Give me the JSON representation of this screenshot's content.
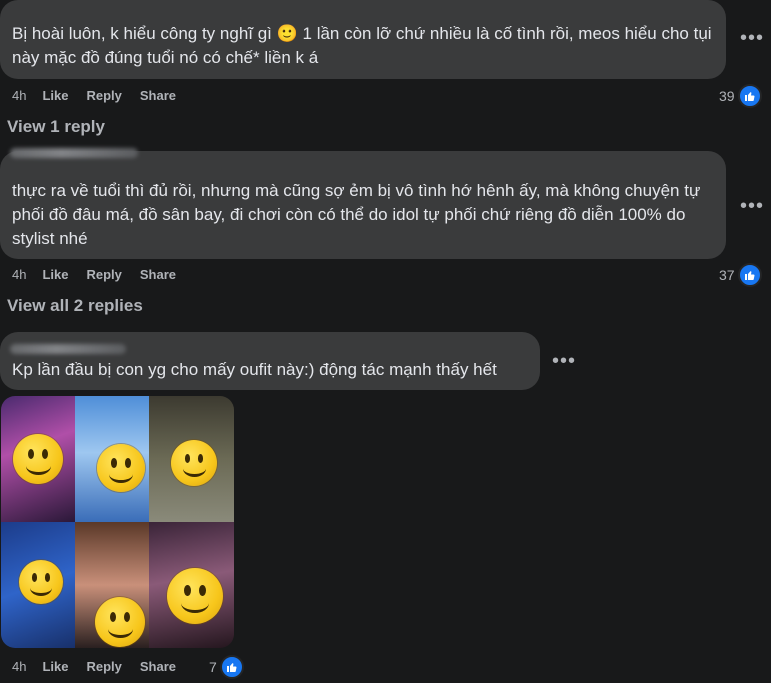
{
  "comments": [
    {
      "text": "Bị hoài luôn, k hiểu công ty nghĩ gì 🙂 1 lần còn lỡ chứ nhiều là cố tình rồi, meos hiểu cho tụi này mặc đồ đúng tuổi nó có chế* liền k á",
      "time": "4h",
      "like_label": "Like",
      "reply_label": "Reply",
      "share_label": "Share",
      "reaction_count": "39",
      "view_replies": "View 1 reply"
    },
    {
      "text": "thực ra về tuổi thì đủ rồi, nhưng mà cũng sợ ẻm bị vô tình hớ hênh ấy, mà không chuyện tự phối đồ đâu má, đồ sân bay, đi chơi còn có thể do idol tự phối chứ riêng đồ diễn 100% do stylist nhé",
      "time": "4h",
      "like_label": "Like",
      "reply_label": "Reply",
      "share_label": "Share",
      "reaction_count": "37",
      "view_replies": "View all 2 replies"
    },
    {
      "text": "Kp lần đầu bị con yg cho mấy oufit này:) động tác mạnh thấy hết",
      "time": "4h",
      "like_label": "Like",
      "reply_label": "Reply",
      "share_label": "Share",
      "reaction_count": "7"
    }
  ],
  "more_icon": "more-options-icon",
  "reaction_icon": "like-reaction-icon",
  "colors": {
    "background": "#18191a",
    "bubble": "#3a3b3c",
    "text": "#e4e6eb",
    "secondary": "#b0b3b8",
    "like_blue": "#1877f2"
  }
}
